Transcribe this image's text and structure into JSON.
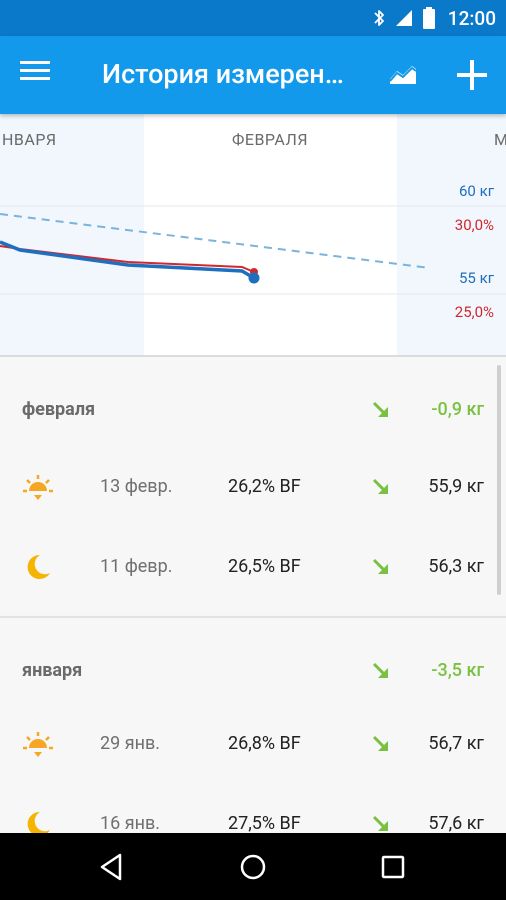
{
  "status_bar": {
    "time": "12:00",
    "icons": [
      "bluetooth-icon",
      "signal-icon",
      "battery-icon"
    ]
  },
  "app_bar": {
    "title": "История измерен…",
    "icons": [
      "menu-icon",
      "chart-icon",
      "add-icon"
    ]
  },
  "chart": {
    "months": {
      "left": "НВАРЯ",
      "center": "ФЕВРАЛЯ",
      "right": "М"
    },
    "axis_labels": {
      "weight_top": "60 кг",
      "fat_top": "30,0%",
      "weight_bottom": "55 кг",
      "fat_bottom": "25,0%"
    },
    "colors": {
      "weight": "#1f6fbf",
      "fat": "#d0282e",
      "target": "#7ab3dc",
      "highlight": "#ffffff",
      "background": "#f1f7fd"
    }
  },
  "groups": [
    {
      "title": "февраля",
      "delta": "-0,9 кг",
      "entries": [
        {
          "time_icon": "sun-icon",
          "date": "13 февр.",
          "body_fat": "26,2% BF",
          "weight": "55,9 кг",
          "trend_icon": "arrow-down-right-icon"
        },
        {
          "time_icon": "moon-icon",
          "date": "11 февр.",
          "body_fat": "26,5% BF",
          "weight": "56,3 кг",
          "trend_icon": "arrow-down-right-icon"
        }
      ]
    },
    {
      "title": "января",
      "delta": "-3,5 кг",
      "entries": [
        {
          "time_icon": "sun-icon",
          "date": "29 янв.",
          "body_fat": "26,8% BF",
          "weight": "56,7 кг",
          "trend_icon": "arrow-down-right-icon"
        },
        {
          "time_icon": "moon-icon",
          "date": "16 янв.",
          "body_fat": "27,5% BF",
          "weight": "57,6 кг",
          "trend_icon": "arrow-down-right-icon"
        }
      ]
    }
  ],
  "colors": {
    "accent": "#1399ec",
    "status": "#0b79c9",
    "positive": "#7ac142",
    "sun": "#f5a623",
    "moon": "#f5b400"
  },
  "nav_bar": {
    "icons": [
      "back-icon",
      "home-icon",
      "recents-icon"
    ]
  }
}
